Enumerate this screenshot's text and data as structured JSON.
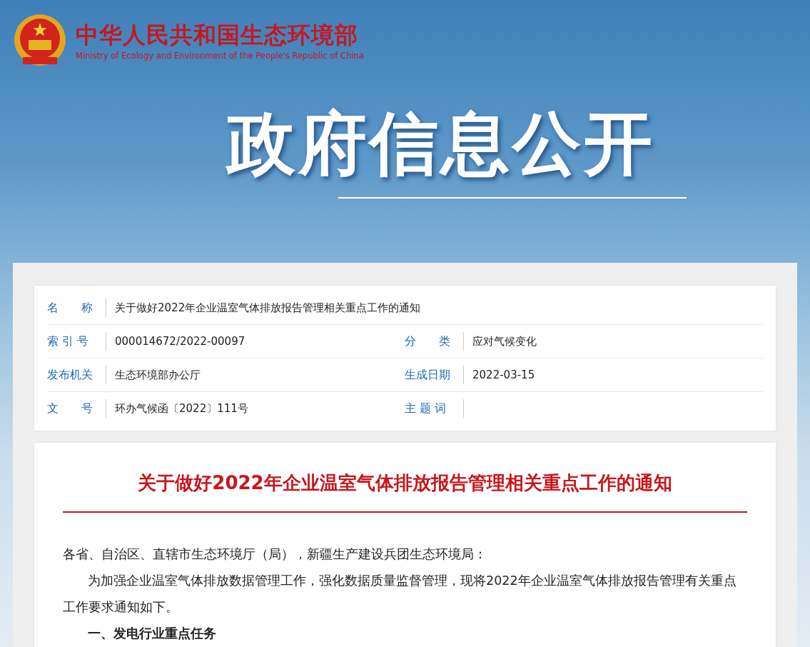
{
  "header": {
    "site_name": "中华人民共和国生态环境部",
    "site_name_en": "Ministry of Ecology and Environment of the People's Republic of China",
    "banner_title": "政府信息公开"
  },
  "metadata": {
    "rows": [
      {
        "fields": [
          {
            "label": "名　　称",
            "value": "关于做好2022年企业温室气体排放报告管理相关重点工作的通知"
          }
        ]
      },
      {
        "fields": [
          {
            "label": "索 引 号",
            "value": "000014672/2022-00097"
          },
          {
            "label": "分　　类",
            "value": "应对气候变化"
          }
        ]
      },
      {
        "fields": [
          {
            "label": "发布机关",
            "value": "生态环境部办公厅"
          },
          {
            "label": "生成日期",
            "value": "2022-03-15"
          }
        ]
      },
      {
        "fields": [
          {
            "label": "文　　号",
            "value": "环办气候函〔2022〕111号"
          },
          {
            "label": "主 题 词"
          }
        ]
      }
    ]
  },
  "article": {
    "title": "关于做好2022年企业温室气体排放报告管理相关重点工作的通知",
    "paragraphs": [
      {
        "kind": "salutation",
        "text": "各省、自治区、直辖市生态环境厅（局），新疆生产建设兵团生态环境局："
      },
      {
        "kind": "body",
        "text": "为加强企业温室气体排放数据管理工作，强化数据质量监督管理，现将2022年企业温室气体排放报告管理有关重点工作要求通知如下。"
      },
      {
        "kind": "heading",
        "text": "一、发电行业重点任务"
      }
    ]
  }
}
